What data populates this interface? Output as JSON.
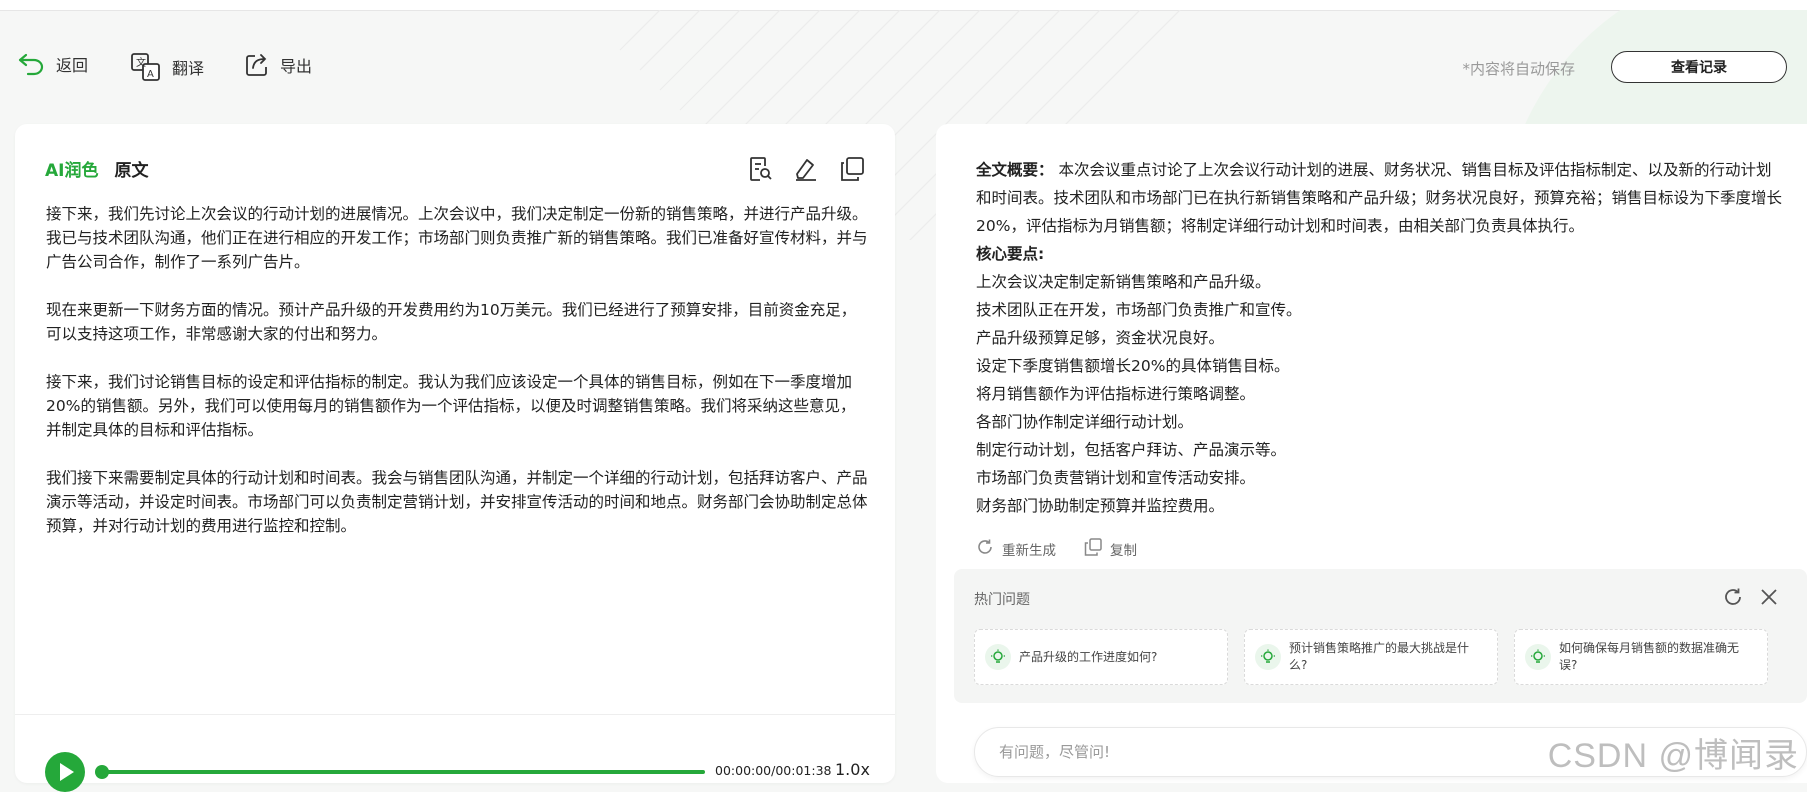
{
  "toolbar": {
    "back_label": "返回",
    "translate_label": "翻译",
    "export_label": "导出",
    "autosave_text": "*内容将自动保存",
    "records_label": "查看记录"
  },
  "left": {
    "tab_ai": "AI润色",
    "tab_original": "原文",
    "paragraphs": [
      "接下来，我们先讨论上次会议的行动计划的进展情况。上次会议中，我们决定制定一份新的销售策略，并进行产品升级。我已与技术团队沟通，他们正在进行相应的开发工作；市场部门则负责推广新的销售策略。我们已准备好宣传材料，并与广告公司合作，制作了一系列广告片。",
      "现在来更新一下财务方面的情况。预计产品升级的开发费用约为10万美元。我们已经进行了预算安排，目前资金充足，可以支持这项工作，非常感谢大家的付出和努力。",
      "接下来，我们讨论销售目标的设定和评估指标的制定。我认为我们应该设定一个具体的销售目标，例如在下一季度增加20%的销售额。另外，我们可以使用每月的销售额作为一个评估指标，以便及时调整销售策略。我们将采纳这些意见，并制定具体的目标和评估指标。",
      "我们接下来需要制定具体的行动计划和时间表。我会与销售团队沟通，并制定一个详细的行动计划，包括拜访客户、产品演示等活动，并设定时间表。市场部门可以负责制定营销计划，并安排宣传活动的时间和地点。财务部门会协助制定总体预算，并对行动计划的费用进行监控和控制。"
    ],
    "player": {
      "time": "00:00:00/00:01:38",
      "speed": "1.0x",
      "progress": 0
    }
  },
  "right": {
    "summary_label": "全文概要：",
    "summary_text": "本次会议重点讨论了上次会议行动计划的进展、财务状况、销售目标及评估指标制定、以及新的行动计划和时间表。技术团队和市场部门已在执行新销售策略和产品升级；财务状况良好，预算充裕；销售目标设为下季度增长20%，评估指标为月销售额；将制定详细行动计划和时间表，由相关部门负责具体执行。",
    "points_label": "核心要点:",
    "points": [
      "上次会议决定制定新销售策略和产品升级。",
      "技术团队正在开发，市场部门负责推广和宣传。",
      "产品升级预算足够，资金状况良好。",
      "设定下季度销售额增长20%的具体销售目标。",
      "将月销售额作为评估指标进行策略调整。",
      "各部门协作制定详细行动计划。",
      "制定行动计划，包括客户拜访、产品演示等。",
      "市场部门负责营销计划和宣传活动安排。",
      "财务部门协助制定预算并监控费用。"
    ],
    "regenerate_label": "重新生成",
    "copy_label": "复制",
    "hot": {
      "title": "热门问题",
      "questions": [
        "产品升级的工作进度如何?",
        "预计销售策略推广的最大挑战是什么?",
        "如何确保每月销售额的数据准确无误?"
      ]
    },
    "chat_placeholder": "有问题，尽管问!"
  },
  "watermark": "CSDN @博闻录",
  "colors": {
    "accent": "#25a83a"
  }
}
